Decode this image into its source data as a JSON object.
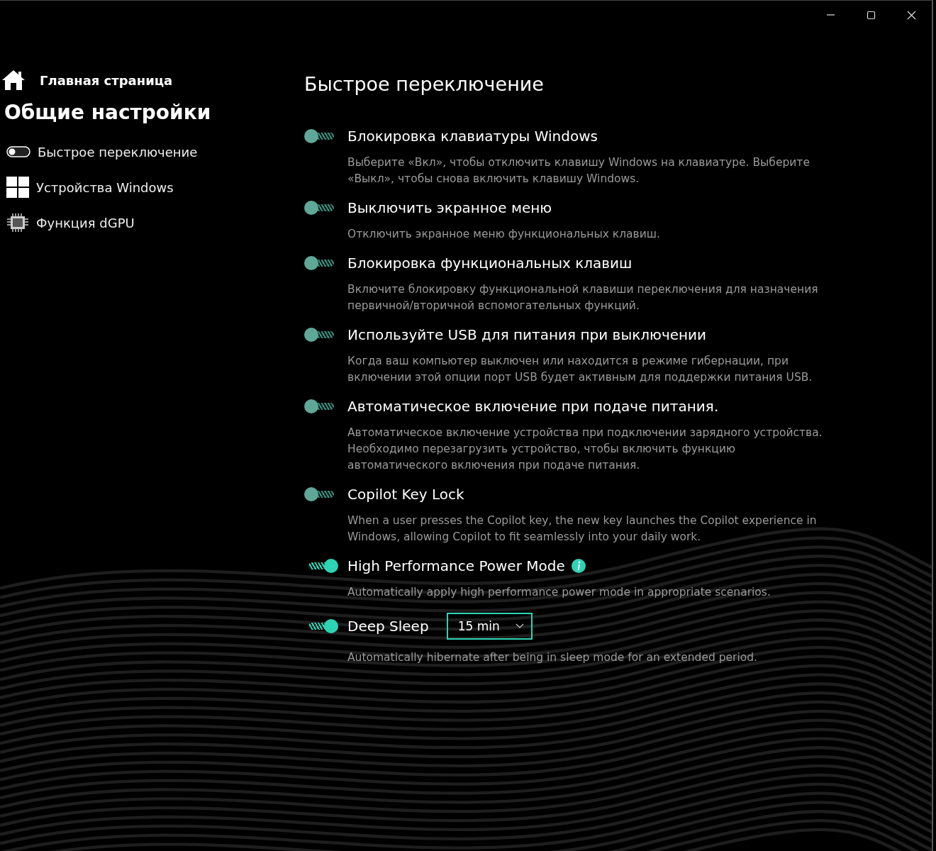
{
  "sidebar": {
    "home": {
      "label": "Главная страница"
    },
    "heading": "Общие настройки",
    "items": [
      {
        "label": "Быстрое переключение"
      },
      {
        "label": "Устройства Windows"
      },
      {
        "label": "Функция dGPU"
      }
    ]
  },
  "page": {
    "title": "Быстрое переключение",
    "settings": [
      {
        "title": "Блокировка клавиатуры Windows",
        "description": "Выберите «Вкл», чтобы отключить клавишу Windows на клавиатуре. Выберите «Выкл», чтобы снова включить клавишу Windows.",
        "on": false
      },
      {
        "title": "Выключить экранное меню",
        "description": "Отключить экранное меню функциональных клавиш.",
        "on": false
      },
      {
        "title": "Блокировка функциональных клавиш",
        "description": "Включите блокировку функциональной клавиши переключения для назначения первичной/вторичной вспомогательных функций.",
        "on": false
      },
      {
        "title": "Используйте USB для питания при выключении",
        "description": "Когда ваш компьютер выключен или находится в режиме гибернации, при включении этой опции порт USB будет активным для поддержки питания USB.",
        "on": false
      },
      {
        "title": "Автоматическое включение при подаче питания.",
        "description": "Автоматическое включение устройства при подключении зарядного устройства. Необходимо перезагрузить устройство, чтобы включить функцию автоматического включения при подаче питания.",
        "on": false
      },
      {
        "title": "Copilot Key Lock",
        "description": "When a user presses the Copilot key, the new key launches the Copilot experience in Windows, allowing Copilot to fit seamlessly into your daily work.",
        "on": false
      },
      {
        "title": "High Performance Power Mode",
        "description": "Automatically apply high performance power mode in appropriate scenarios.",
        "on": true,
        "info": true
      },
      {
        "title": "Deep Sleep",
        "description": "Automatically hibernate after being in sleep mode for an extended period.",
        "on": true,
        "dropdown": {
          "value": "15 min"
        }
      }
    ]
  }
}
